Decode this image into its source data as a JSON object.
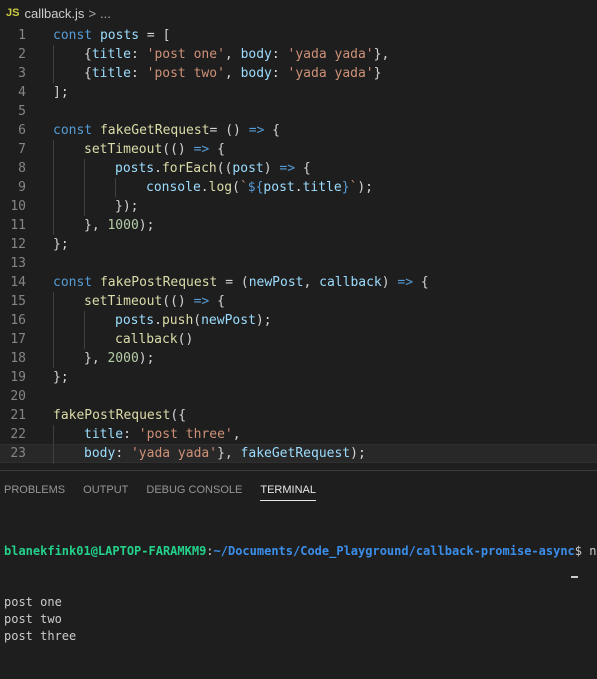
{
  "breadcrumb": {
    "badge": "JS",
    "file": "callback.js",
    "separator": ">",
    "ellipsis": "..."
  },
  "editor": {
    "lines": [
      {
        "n": "1",
        "indent": 0,
        "tokens": [
          [
            "const ",
            "t-kw"
          ],
          [
            "posts",
            "t-var"
          ],
          [
            " = [",
            "t-op"
          ]
        ]
      },
      {
        "n": "2",
        "indent": 1,
        "tokens": [
          [
            "{",
            "t-p"
          ],
          [
            "title",
            "t-prop"
          ],
          [
            ": ",
            "t-p"
          ],
          [
            "'post one'",
            "t-str"
          ],
          [
            ", ",
            "t-p"
          ],
          [
            "body",
            "t-prop"
          ],
          [
            ": ",
            "t-p"
          ],
          [
            "'yada yada'",
            "t-str"
          ],
          [
            "},",
            "t-p"
          ]
        ]
      },
      {
        "n": "3",
        "indent": 1,
        "tokens": [
          [
            "{",
            "t-p"
          ],
          [
            "title",
            "t-prop"
          ],
          [
            ": ",
            "t-p"
          ],
          [
            "'post two'",
            "t-str"
          ],
          [
            ", ",
            "t-p"
          ],
          [
            "body",
            "t-prop"
          ],
          [
            ": ",
            "t-p"
          ],
          [
            "'yada yada'",
            "t-str"
          ],
          [
            "}",
            "t-p"
          ]
        ]
      },
      {
        "n": "4",
        "indent": 0,
        "tokens": [
          [
            "];",
            "t-p"
          ]
        ]
      },
      {
        "n": "5",
        "indent": 0,
        "tokens": []
      },
      {
        "n": "6",
        "indent": 0,
        "tokens": [
          [
            "const ",
            "t-kw"
          ],
          [
            "fakeGetRequest",
            "t-fn"
          ],
          [
            "= () ",
            "t-p"
          ],
          [
            "=>",
            "t-kw"
          ],
          [
            " {",
            "t-p"
          ]
        ]
      },
      {
        "n": "7",
        "indent": 1,
        "tokens": [
          [
            "setTimeout",
            "t-fn"
          ],
          [
            "(() ",
            "t-p"
          ],
          [
            "=>",
            "t-kw"
          ],
          [
            " {",
            "t-p"
          ]
        ]
      },
      {
        "n": "8",
        "indent": 2,
        "tokens": [
          [
            "posts",
            "t-var"
          ],
          [
            ".",
            "t-p"
          ],
          [
            "forEach",
            "t-fn"
          ],
          [
            "((",
            "t-p"
          ],
          [
            "post",
            "t-var"
          ],
          [
            ") ",
            "t-p"
          ],
          [
            "=>",
            "t-kw"
          ],
          [
            " {",
            "t-p"
          ]
        ]
      },
      {
        "n": "9",
        "indent": 3,
        "tokens": [
          [
            "console",
            "t-var"
          ],
          [
            ".",
            "t-p"
          ],
          [
            "log",
            "t-fn"
          ],
          [
            "(",
            "t-p"
          ],
          [
            "`",
            "t-str"
          ],
          [
            "${",
            "t-kw"
          ],
          [
            "post",
            "t-var"
          ],
          [
            ".",
            "t-p"
          ],
          [
            "title",
            "t-var"
          ],
          [
            "}",
            "t-kw"
          ],
          [
            "`",
            "t-str"
          ],
          [
            ");",
            "t-p"
          ]
        ]
      },
      {
        "n": "10",
        "indent": 2,
        "tokens": [
          [
            "});",
            "t-p"
          ]
        ]
      },
      {
        "n": "11",
        "indent": 1,
        "tokens": [
          [
            "}, ",
            "t-p"
          ],
          [
            "1000",
            "t-num"
          ],
          [
            ");",
            "t-p"
          ]
        ]
      },
      {
        "n": "12",
        "indent": 0,
        "tokens": [
          [
            "};",
            "t-p"
          ]
        ]
      },
      {
        "n": "13",
        "indent": 0,
        "tokens": []
      },
      {
        "n": "14",
        "indent": 0,
        "tokens": [
          [
            "const ",
            "t-kw"
          ],
          [
            "fakePostRequest",
            "t-fn"
          ],
          [
            " = (",
            "t-p"
          ],
          [
            "newPost",
            "t-var"
          ],
          [
            ", ",
            "t-p"
          ],
          [
            "callback",
            "t-var"
          ],
          [
            ") ",
            "t-p"
          ],
          [
            "=>",
            "t-kw"
          ],
          [
            " {",
            "t-p"
          ]
        ]
      },
      {
        "n": "15",
        "indent": 1,
        "tokens": [
          [
            "setTimeout",
            "t-fn"
          ],
          [
            "(() ",
            "t-p"
          ],
          [
            "=>",
            "t-kw"
          ],
          [
            " {",
            "t-p"
          ]
        ]
      },
      {
        "n": "16",
        "indent": 2,
        "tokens": [
          [
            "posts",
            "t-var"
          ],
          [
            ".",
            "t-p"
          ],
          [
            "push",
            "t-fn"
          ],
          [
            "(",
            "t-p"
          ],
          [
            "newPost",
            "t-var"
          ],
          [
            ");",
            "t-p"
          ]
        ]
      },
      {
        "n": "17",
        "indent": 2,
        "tokens": [
          [
            "callback",
            "t-fn"
          ],
          [
            "()",
            "t-p"
          ]
        ]
      },
      {
        "n": "18",
        "indent": 1,
        "tokens": [
          [
            "}, ",
            "t-p"
          ],
          [
            "2000",
            "t-num"
          ],
          [
            ");",
            "t-p"
          ]
        ]
      },
      {
        "n": "19",
        "indent": 0,
        "tokens": [
          [
            "};",
            "t-p"
          ]
        ]
      },
      {
        "n": "20",
        "indent": 0,
        "tokens": []
      },
      {
        "n": "21",
        "indent": 0,
        "tokens": [
          [
            "fakePostRequest",
            "t-fn"
          ],
          [
            "({",
            "t-p"
          ]
        ]
      },
      {
        "n": "22",
        "indent": 1,
        "tokens": [
          [
            "title",
            "t-prop"
          ],
          [
            ": ",
            "t-p"
          ],
          [
            "'post three'",
            "t-str"
          ],
          [
            ",",
            "t-p"
          ]
        ]
      },
      {
        "n": "23",
        "indent": 1,
        "active": true,
        "tokens": [
          [
            "body",
            "t-prop"
          ],
          [
            ": ",
            "t-p"
          ],
          [
            "'yada yada'",
            "t-str"
          ],
          [
            "}, ",
            "t-p"
          ],
          [
            "fakeGetRequest",
            "t-var"
          ],
          [
            ");",
            "t-p"
          ]
        ]
      }
    ]
  },
  "panel": {
    "tabs": [
      {
        "label": "PROBLEMS",
        "active": false
      },
      {
        "label": "OUTPUT",
        "active": false
      },
      {
        "label": "DEBUG CONSOLE",
        "active": false
      },
      {
        "label": "TERMINAL",
        "active": true
      }
    ],
    "terminal": {
      "prompt_user": "blanekfink01@LAPTOP-FARAMKM9",
      "prompt_colon": ":",
      "prompt_path": "~/Documents/Code_Playground/callback-promise-async",
      "prompt_rest": "$ node",
      "output": [
        "post one",
        "post two",
        "post three"
      ]
    }
  },
  "colors": {
    "background": "#1e1e1e",
    "keyword": "#569cd6",
    "variable": "#9cdcfe",
    "function": "#dcdcaa",
    "string": "#ce9178",
    "number": "#b5cea8",
    "prompt_user": "#23d18b",
    "prompt_path": "#3b8eea"
  }
}
